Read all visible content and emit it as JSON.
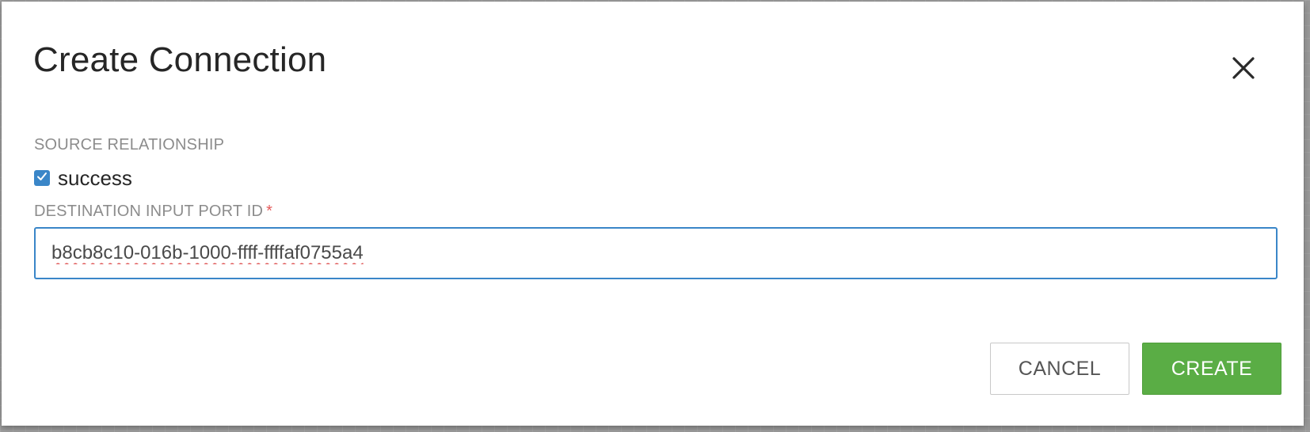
{
  "dialog": {
    "title": "Create Connection",
    "close_icon": "close-icon",
    "source_relationship": {
      "label": "SOURCE RELATIONSHIP",
      "options": [
        {
          "label": "success",
          "checked": true
        }
      ]
    },
    "destination": {
      "label": "DESTINATION INPUT PORT ID",
      "required_mark": "*",
      "value": "b8cb8c10-016b-1000-ffff-ffffaf0755a4"
    },
    "buttons": {
      "cancel": "CANCEL",
      "create": "CREATE"
    }
  },
  "colors": {
    "accent": "#3a86c8",
    "primary_button": "#5aad45",
    "required": "#e45a5a"
  }
}
